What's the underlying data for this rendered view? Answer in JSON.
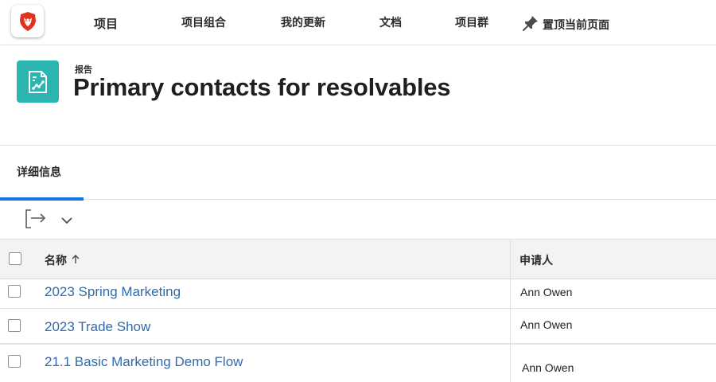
{
  "nav": {
    "logo_icon": "lion-logo-icon",
    "items": [
      "项目",
      "项目组合",
      "我的更新",
      "文档",
      "项目群"
    ],
    "pin_icon": "pushpin-icon",
    "pin_label": "置顶当前页面"
  },
  "header": {
    "icon": "report-icon",
    "icon_color": "#2ab5b1",
    "kicker": "报告",
    "title": "Primary contacts for resolvables"
  },
  "tabs": [
    {
      "label": "详细信息",
      "active": true
    }
  ],
  "toolbar": {
    "export_icon": "export-icon",
    "dropdown_icon": "chevron-down-icon"
  },
  "table": {
    "columns": [
      {
        "label": "名称",
        "sort": "ascending",
        "sort_icon": "arrow-up-icon"
      },
      {
        "label": "申请人"
      }
    ],
    "rows": [
      {
        "name": "2023 Spring Marketing",
        "requestor": "Ann Owen"
      },
      {
        "name": "2023 Trade Show",
        "requestor": "Ann Owen"
      },
      {
        "name": "21.1 Basic Marketing Demo Flow",
        "requestor": "Ann Owen"
      }
    ]
  },
  "colors": {
    "accent_blue": "#1473e6",
    "link_blue": "#2f6bb0",
    "logo_red": "#e0321c"
  }
}
